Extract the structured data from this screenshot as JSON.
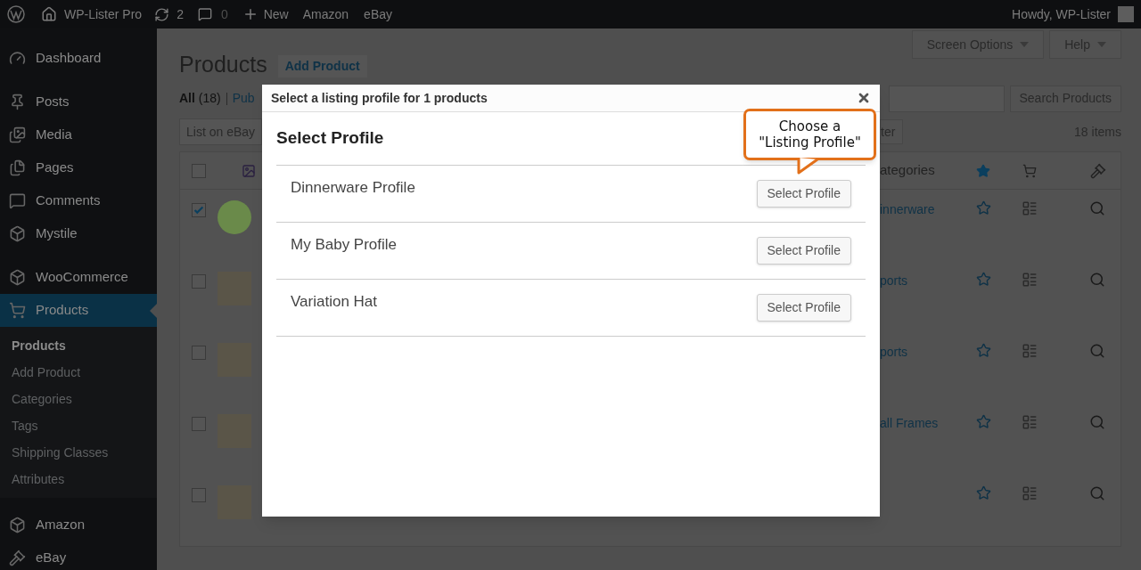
{
  "admin_bar": {
    "site": "WP-Lister Pro",
    "updates": "2",
    "comments": "0",
    "new": "New",
    "links": [
      "Amazon",
      "eBay"
    ],
    "greeting": "Howdy, WP-Lister"
  },
  "sidebar": {
    "items": [
      {
        "label": "Dashboard",
        "selected": false
      },
      {
        "label": "Posts",
        "selected": false
      },
      {
        "label": "Media",
        "selected": false
      },
      {
        "label": "Pages",
        "selected": false
      },
      {
        "label": "Comments",
        "selected": false
      },
      {
        "label": "Mystile",
        "selected": false
      },
      {
        "label": "WooCommerce",
        "selected": false
      },
      {
        "label": "Products",
        "selected": true,
        "children": [
          {
            "label": "Products",
            "selected": true
          },
          {
            "label": "Add Product",
            "selected": false
          },
          {
            "label": "Categories",
            "selected": false
          },
          {
            "label": "Tags",
            "selected": false
          },
          {
            "label": "Shipping Classes",
            "selected": false
          },
          {
            "label": "Attributes",
            "selected": false
          }
        ]
      },
      {
        "label": "Amazon",
        "selected": false
      },
      {
        "label": "eBay",
        "selected": false
      }
    ]
  },
  "page": {
    "title": "Products",
    "add_button": "Add Product",
    "screen_options": "Screen Options",
    "help": "Help",
    "views": [
      {
        "label": "All",
        "count": "(18)",
        "selected": true
      },
      {
        "label": "Pub",
        "selected": false
      }
    ],
    "bulk_action": "List on eBay",
    "filter_button": "ter",
    "search_button": "Search Products",
    "item_count": "18 items"
  },
  "table": {
    "header": {
      "checked": false,
      "column_3": "ategories"
    },
    "rows": [
      {
        "checked": true,
        "column_3": "innerware"
      },
      {
        "checked": false,
        "column_3": "ports"
      },
      {
        "checked": false,
        "column_3": "ports"
      },
      {
        "checked": false,
        "column_3": "all Frames"
      },
      {
        "checked": false
      }
    ]
  },
  "modal": {
    "title": "Select a listing profile for 1 products",
    "heading": "Select Profile",
    "profiles": [
      {
        "name": "Dinnerware Profile",
        "button": "Select Profile"
      },
      {
        "name": "My Baby Profile",
        "button": "Select Profile"
      },
      {
        "name": "Variation Hat",
        "button": "Select Profile"
      }
    ],
    "callout": [
      "Choose a",
      "\"Listing Profile\""
    ]
  }
}
